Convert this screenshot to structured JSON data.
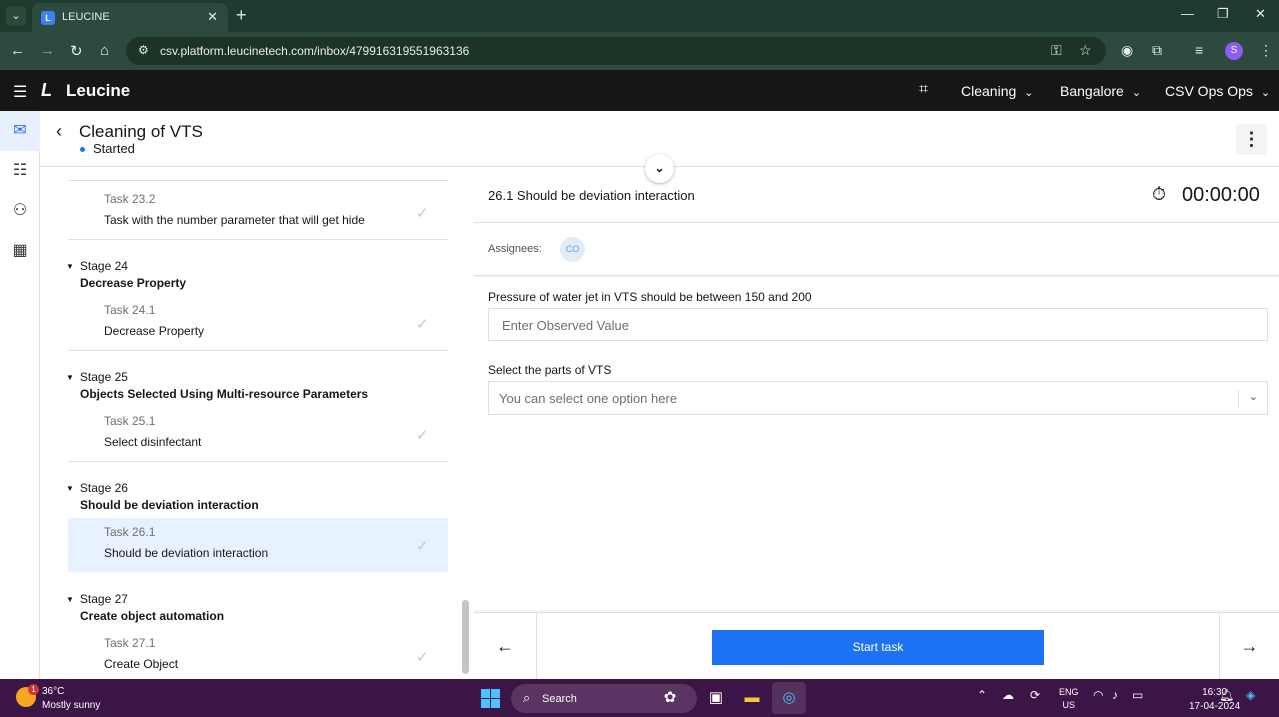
{
  "browser": {
    "tab_title": "LEUCINE",
    "url": "csv.platform.leucinetech.com/inbox/479916319551963136",
    "profile_initial": "S"
  },
  "app": {
    "logo_text": "Leucine",
    "use_case": "Cleaning",
    "facility": "Bangalore",
    "user": "CSV Ops Ops"
  },
  "job": {
    "title": "Cleaning of VTS",
    "status": "Started"
  },
  "tasklist": {
    "top_task": {
      "num": "Task 23.2",
      "name": "Task with the number parameter that will get hide"
    },
    "stages": [
      {
        "num": "Stage 24",
        "name": "Decrease Property",
        "task_num": "Task 24.1",
        "task_name": "Decrease Property"
      },
      {
        "num": "Stage 25",
        "name": "Objects Selected Using Multi-resource Parameters",
        "task_num": "Task 25.1",
        "task_name": "Select disinfectant"
      },
      {
        "num": "Stage 26",
        "name": "Should be deviation interaction",
        "task_num": "Task 26.1",
        "task_name": "Should be deviation interaction"
      },
      {
        "num": "Stage 27",
        "name": "Create object automation",
        "task_num": "Task 27.1",
        "task_name": "Create Object"
      }
    ]
  },
  "task": {
    "title": "26.1 Should be deviation interaction",
    "timer": "00:00:00",
    "assignees_label": "Assignees:",
    "assignee_initials": "CO",
    "param1_label": "Pressure of water jet in VTS should be between 150 and 200",
    "param1_placeholder": "Enter Observed Value",
    "param2_label": "Select the parts of VTS",
    "param2_placeholder": "You can select one option here",
    "start_label": "Start task"
  },
  "taskbar": {
    "weather_badge": "1",
    "temperature": "36°C",
    "weather": "Mostly sunny",
    "search_label": "Search",
    "lang_line1": "ENG",
    "lang_line2": "US",
    "time": "16:30",
    "date": "17-04-2024"
  },
  "colors": {
    "accent": "#1d72f3",
    "header_bg": "#161616",
    "active_task_bg": "#e7f1ff"
  }
}
